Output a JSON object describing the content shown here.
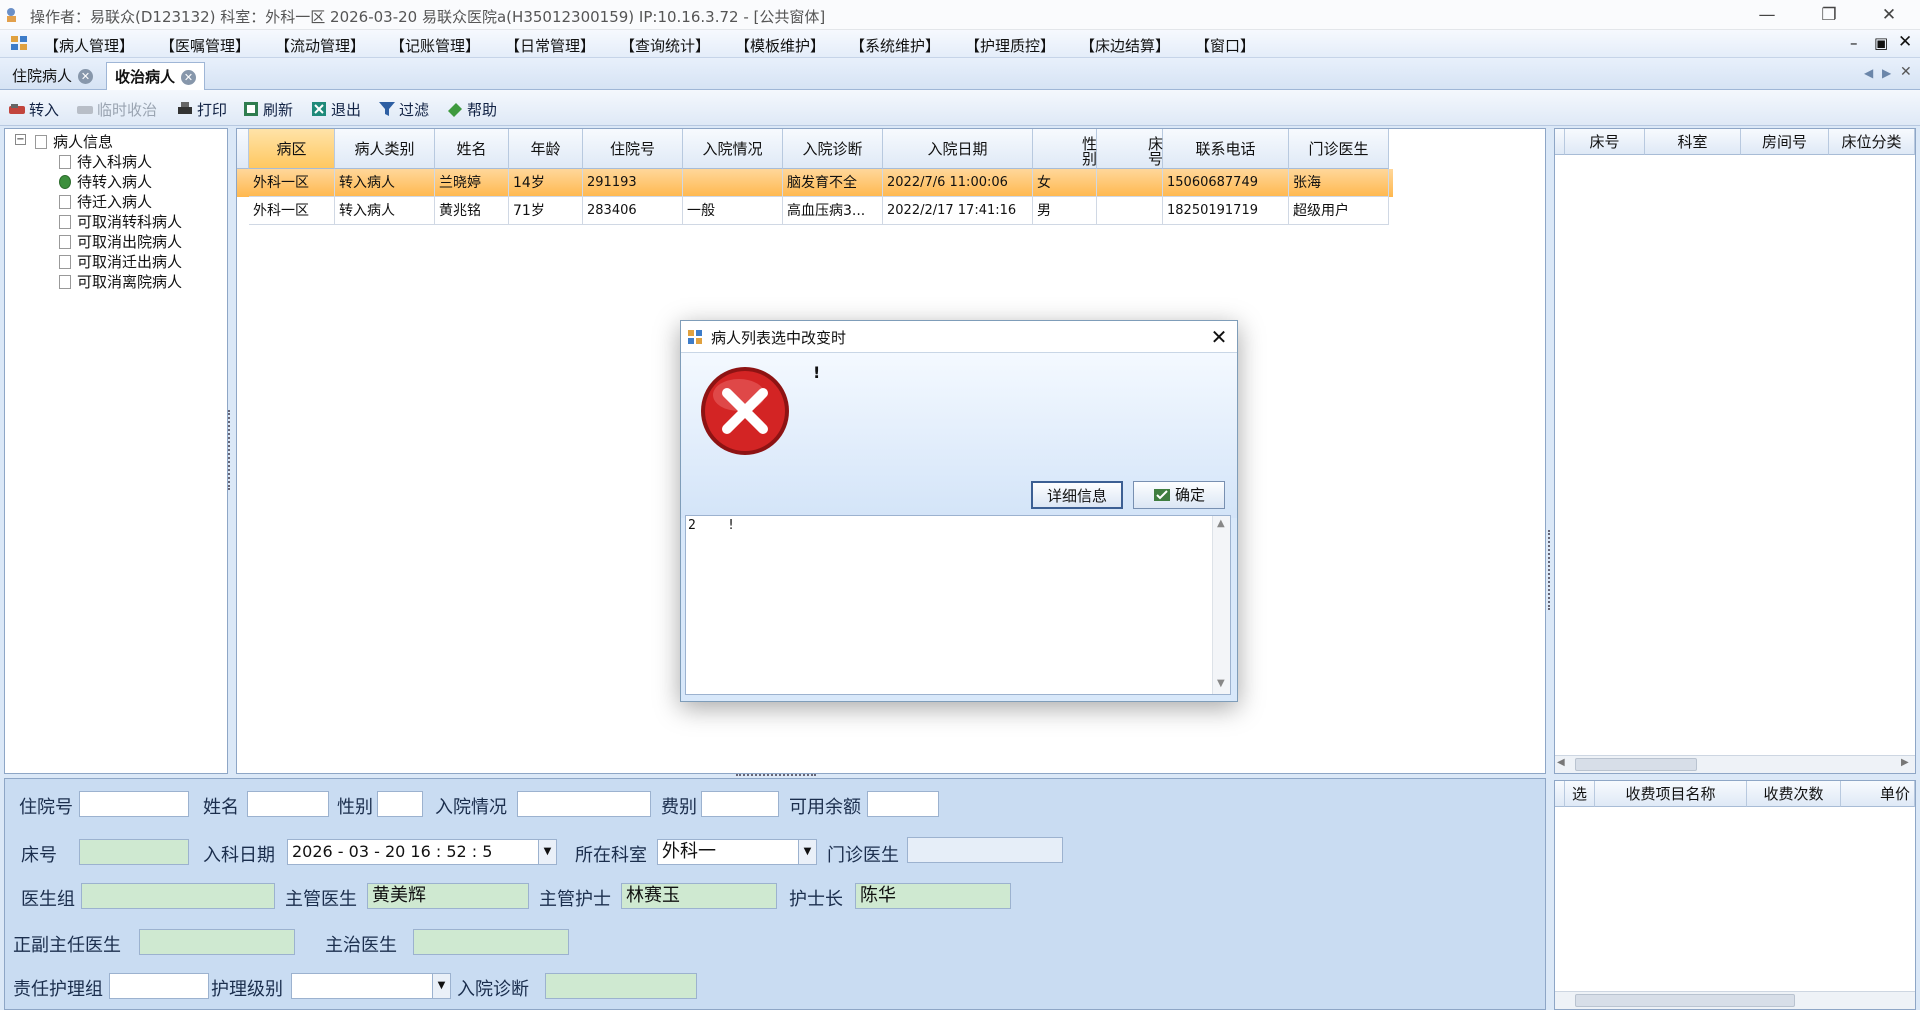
{
  "window": {
    "title": "操作者：易联众(D123132) 科室：外科一区 2026-03-20 易联众医院a(H35012300159) IP:10.16.3.72 - [公共窗体]"
  },
  "menu": [
    "【病人管理】",
    "【医嘱管理】",
    "【流动管理】",
    "【记账管理】",
    "【日常管理】",
    "【查询统计】",
    "【模板维护】",
    "【系统维护】",
    "【护理质控】",
    "【床边结算】",
    "【窗口】"
  ],
  "tabs": [
    {
      "label": "住院病人"
    },
    {
      "label": "收治病人"
    }
  ],
  "toolbar": {
    "transfer_in": "转入",
    "temp_admit": "临时收治",
    "print": "打印",
    "refresh": "刷新",
    "exit": "退出",
    "filter": "过滤",
    "help": "帮助"
  },
  "tree": {
    "root": "病人信息",
    "items": [
      "待入科病人",
      "待转入病人",
      "待迁入病人",
      "可取消转科病人",
      "可取消出院病人",
      "可取消迁出病人",
      "可取消离院病人"
    ]
  },
  "grid": {
    "headers": [
      "病区",
      "病人类别",
      "姓名",
      "年龄",
      "住院号",
      "入院情况",
      "入院诊断",
      "入院日期",
      "性别",
      "床号",
      "联系电话",
      "门诊医生"
    ],
    "rows": [
      [
        "外科一区",
        "转入病人",
        "兰晓婷",
        "14岁",
        "291193",
        "",
        "脑发育不全",
        "2022/7/6 11:00:06",
        "女",
        "",
        "15060687749",
        "张海"
      ],
      [
        "外科一区",
        "转入病人",
        "黄兆铭",
        "71岁",
        "283406",
        "一般",
        "高血压病3...",
        "2022/2/17 17:41:16",
        "男",
        "",
        "18250191719",
        "超级用户"
      ]
    ]
  },
  "right_top": {
    "headers": [
      "床号",
      "科室",
      "房间号",
      "床位分类"
    ]
  },
  "right_bottom": {
    "headers": [
      "选",
      "收费项目名称",
      "收费次数",
      "单价"
    ]
  },
  "form": {
    "labels": {
      "admission_no": "住院号",
      "name": "姓名",
      "gender": "性别",
      "admission_status": "入院情况",
      "fee_type": "费别",
      "balance": "可用余额",
      "bed_no": "床号",
      "dept_date": "入科日期",
      "dept": "所在科室",
      "outpatient_doctor": "门诊医生",
      "doctor_group": "医生组",
      "attending_doctor": "主管医生",
      "attending_nurse": "主管护士",
      "head_nurse": "护士长",
      "chief_doctor": "正副主任医生",
      "treating_doctor": "主治医生",
      "nursing_group": "责任护理组",
      "nursing_level": "护理级别",
      "diagnosis": "入院诊断"
    },
    "values": {
      "dept_date": "2026 - 03 - 20   16 : 52 : 5",
      "dept": "外科一",
      "attending_doctor": "黄美辉",
      "attending_nurse": "林赛玉",
      "head_nurse": "陈华"
    }
  },
  "dialog": {
    "title": "病人列表选中改变时",
    "message": "!",
    "details_button": "详细信息",
    "ok_button": "确定",
    "detail_text": "2    !"
  }
}
